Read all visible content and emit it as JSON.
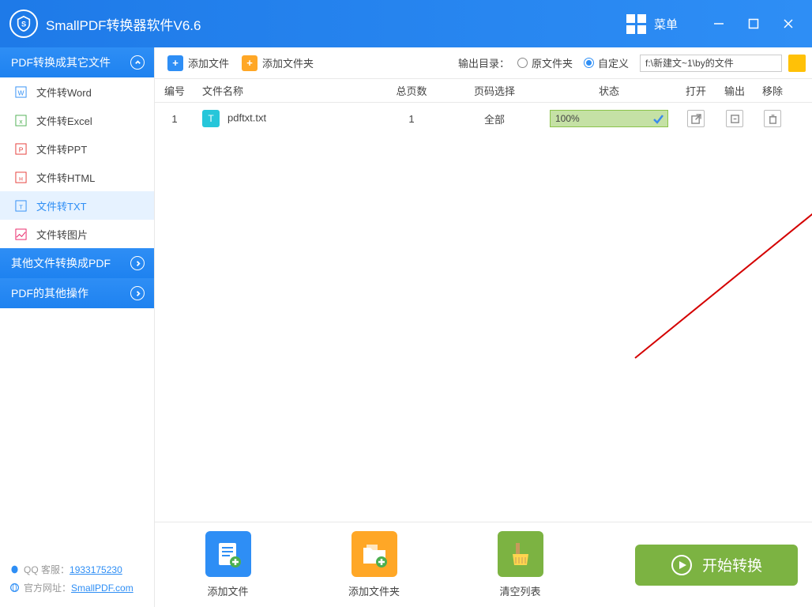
{
  "app": {
    "title": "SmallPDF转换器软件V6.6",
    "menu": "菜单"
  },
  "sidebar": {
    "sec1": "PDF转换成其它文件",
    "items1": [
      "文件转Word",
      "文件转Excel",
      "文件转PPT",
      "文件转HTML",
      "文件转TXT",
      "文件转图片"
    ],
    "sec2": "其他文件转换成PDF",
    "sec3": "PDF的其他操作"
  },
  "footer": {
    "qq_label": "QQ 客服：",
    "qq": "1933175230",
    "site_label": "官方网址：",
    "site": "SmallPDF.com"
  },
  "toolbar": {
    "add_file": "添加文件",
    "add_folder": "添加文件夹",
    "out_label": "输出目录：",
    "opt1": "原文件夹",
    "opt2": "自定义",
    "path": "f:\\新建文~1\\by的文件"
  },
  "columns": {
    "idx": "编号",
    "name": "文件名称",
    "pages": "总页数",
    "sel": "页码选择",
    "status": "状态",
    "open": "打开",
    "out": "输出",
    "del": "移除"
  },
  "rows": [
    {
      "idx": "1",
      "name": "pdftxt.txt",
      "pages": "1",
      "sel": "全部",
      "status": "100%"
    }
  ],
  "bottom": {
    "add_file": "添加文件",
    "add_folder": "添加文件夹",
    "clear": "清空列表",
    "start": "开始转换"
  }
}
